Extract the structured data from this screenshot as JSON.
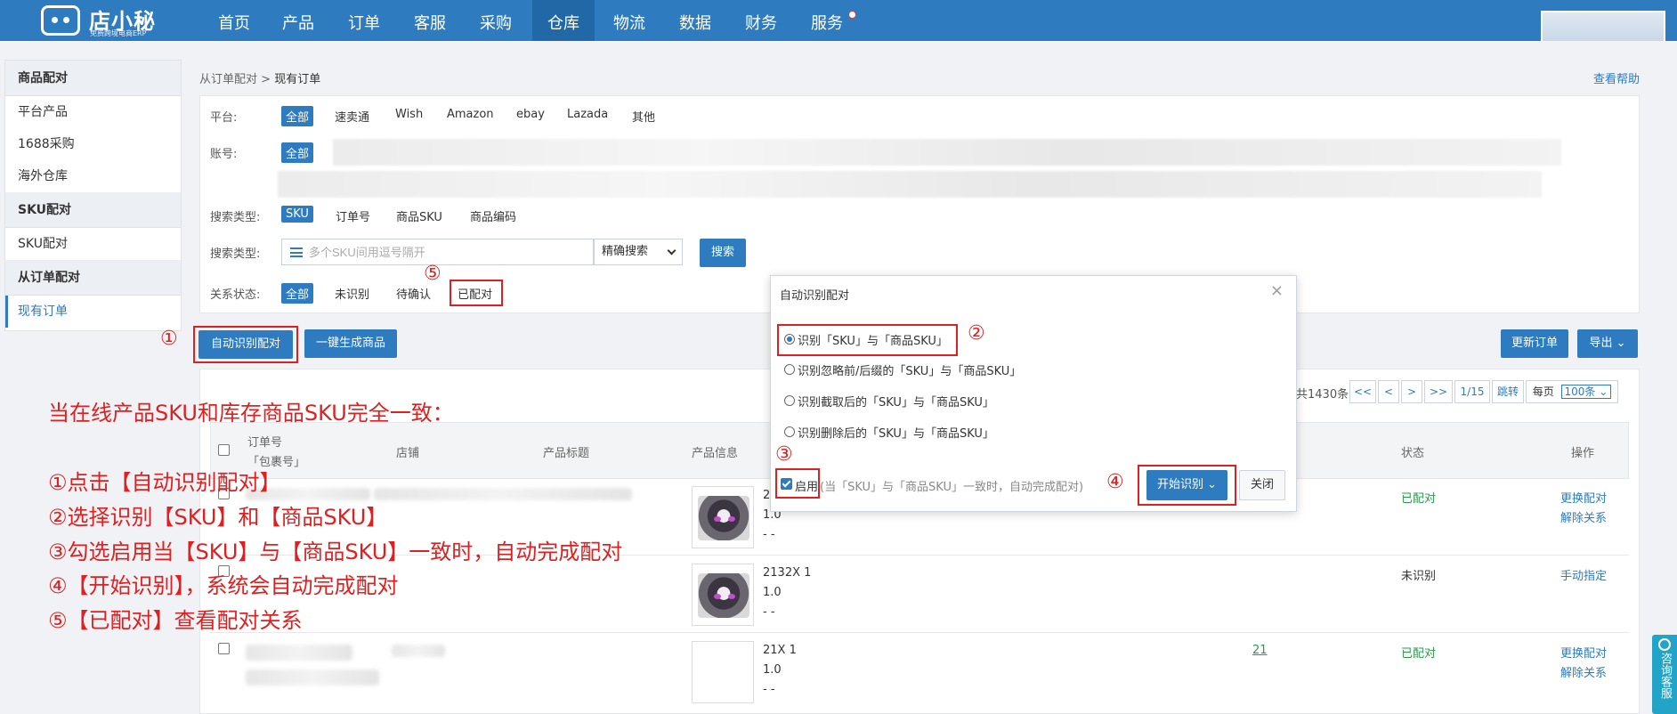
{
  "brand": {
    "name": "店小秘",
    "tagline": "免费跨境电商ERP"
  },
  "nav": [
    {
      "label": "首页"
    },
    {
      "label": "产品"
    },
    {
      "label": "订单"
    },
    {
      "label": "客服"
    },
    {
      "label": "采购"
    },
    {
      "label": "仓库",
      "active": true
    },
    {
      "label": "物流"
    },
    {
      "label": "数据"
    },
    {
      "label": "财务"
    },
    {
      "label": "服务",
      "badge": true
    }
  ],
  "sidebar": {
    "groups": [
      {
        "title": "商品配对",
        "items": [
          "平台产品",
          "1688采购",
          "海外仓库"
        ]
      },
      {
        "title": "SKU配对",
        "items": [
          "SKU配对"
        ]
      },
      {
        "title": "从订单配对",
        "items": [
          "现有订单"
        ]
      }
    ]
  },
  "breadcrumb": {
    "parent": "从订单配对",
    "sep": ">",
    "current": "现有订单"
  },
  "help_link": "查看帮助",
  "filter": {
    "platform_label": "平台:",
    "platforms": [
      "全部",
      "速卖通",
      "Wish",
      "Amazon",
      "ebay",
      "Lazada",
      "其他"
    ],
    "account_label": "账号:",
    "account_all": "全部",
    "search_type_label": "搜索类型:",
    "search_types": [
      "SKU",
      "订单号",
      "商品SKU",
      "商品编码"
    ],
    "search_input_label": "搜索类型:",
    "search_placeholder": "多个SKU间用逗号隔开",
    "search_mode": "精确搜索",
    "search_button": "搜索",
    "relation_label": "关系状态:",
    "relations": [
      "全部",
      "未识别",
      "待确认",
      "已配对"
    ]
  },
  "actions": {
    "auto_match": "自动识别配对",
    "generate": "一键生成商品",
    "update_orders": "更新订单",
    "export": "导出"
  },
  "pagination": {
    "total": "共1430条",
    "first": "<<",
    "prev": "<",
    "next": ">",
    "last": ">>",
    "page": "1/15",
    "jump": "跳转",
    "per_page_label": "每页",
    "per_page": "100条"
  },
  "table": {
    "headers": {
      "order_no": "订单号",
      "package_no": "「包裹号」",
      "store": "店铺",
      "title": "产品标题",
      "info": "产品信息",
      "status": "状态",
      "ops": "操作"
    },
    "rows": [
      {
        "sku": "2",
        "qty": "1.0",
        "dash": "- -",
        "status": "已配对",
        "ops": [
          "更换配对",
          "解除关系"
        ]
      },
      {
        "sku": "2132X 1",
        "qty": "1.0",
        "dash": "- -",
        "status": "未识别",
        "ops": [
          "手动指定"
        ]
      },
      {
        "sku": "21X 1",
        "qty": "1.0",
        "dash": "- -",
        "count": "21",
        "status": "已配对",
        "ops": [
          "更换配对",
          "解除关系"
        ]
      }
    ]
  },
  "modal": {
    "title": "自动识别配对",
    "close": "×",
    "options": [
      "识别「SKU」与「商品SKU」",
      "识别忽略前/后缀的「SKU」与「商品SKU」",
      "识别截取后的「SKU」与「商品SKU」",
      "识别删除后的「SKU」与「商品SKU」"
    ],
    "enable_label": "启用",
    "enable_note": "(当「SKU」与「商品SKU」一致时，自动完成配对)",
    "start_button": "开始识别",
    "close_button": "关闭"
  },
  "annotations": {
    "n1": "①",
    "n2": "②",
    "n3": "③",
    "n4": "④",
    "n5": "⑤"
  },
  "instructions": [
    "当在线产品SKU和库存商品SKU完全一致：",
    "①点击【自动识别配对】",
    "②选择识别【SKU】和【商品SKU】",
    "③勾选启用当【SKU】与【商品SKU】一致时，自动完成配对",
    "④【开始识别】，系统会自动完成配对",
    "⑤【已配对】查看配对关系"
  ],
  "consult": "咨询客服",
  "colors": {
    "primary": "#2e7bbf",
    "annotation_red": "#e02020",
    "paired_green": "#2a9a4a"
  }
}
